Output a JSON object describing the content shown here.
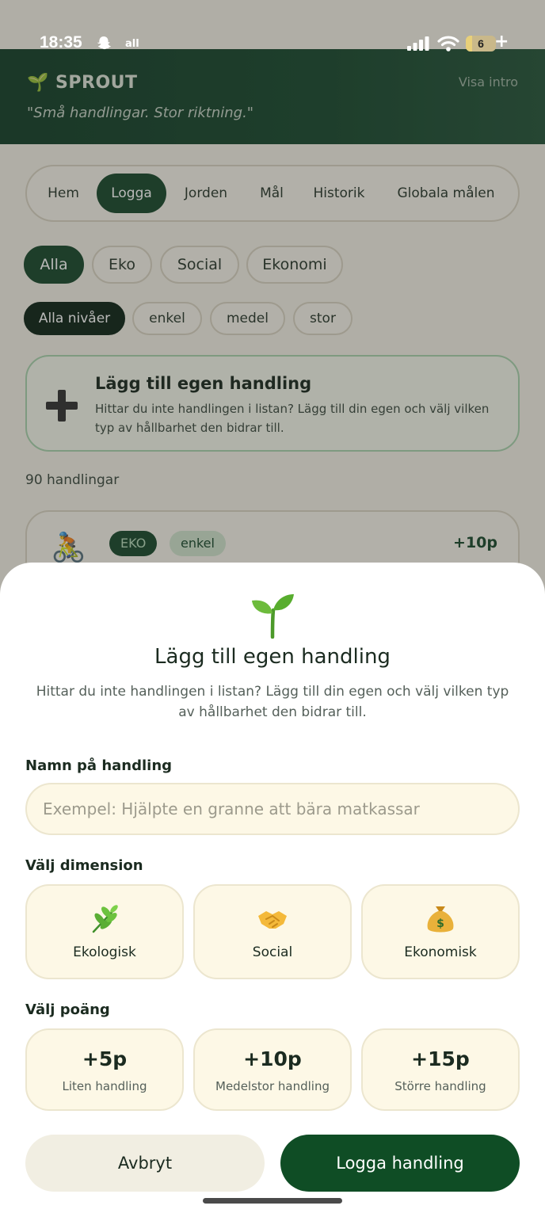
{
  "status_bar": {
    "time": "18:35",
    "network": "all",
    "battery": "6"
  },
  "header": {
    "brand": "🌱 SPROUT",
    "intro_link": "Visa intro",
    "tagline": "\"Små handlingar. Stor riktning.\""
  },
  "tabs": [
    "Hem",
    "Logga",
    "Jorden",
    "Mål",
    "Historik",
    "Globala målen"
  ],
  "active_tab": "Logga",
  "categories": [
    "Alla",
    "Eko",
    "Social",
    "Ekonomi"
  ],
  "levels": [
    "Alla nivåer",
    "enkel",
    "medel",
    "stor"
  ],
  "add_card": {
    "title": "Lägg till egen handling",
    "description": "Hittar du inte handlingen i listan? Lägg till din egen och välj vilken typ av hållbarhet den bidrar till."
  },
  "count": "90 handlingar",
  "first_item": {
    "badge_category": "EKO",
    "badge_level": "enkel",
    "points": "+10p"
  },
  "modal": {
    "title": "Lägg till egen handling",
    "description": "Hittar du inte handlingen i listan? Lägg till din egen och välj vilken typ av hållbarhet den bidrar till.",
    "name_label": "Namn på handling",
    "name_placeholder": "Exempel: Hjälpte en granne att bära matkassar",
    "name_value": "",
    "dimension_label": "Välj dimension",
    "dimensions": [
      {
        "label": "Ekologisk",
        "icon": "herb-icon"
      },
      {
        "label": "Social",
        "icon": "handshake-icon"
      },
      {
        "label": "Ekonomisk",
        "icon": "money-bag-icon"
      }
    ],
    "points_label": "Välj poäng",
    "points": [
      {
        "value": "+5p",
        "label": "Liten handling"
      },
      {
        "value": "+10p",
        "label": "Medelstor handling"
      },
      {
        "value": "+15p",
        "label": "Större handling"
      }
    ],
    "cancel_label": "Avbryt",
    "submit_label": "Logga handling"
  },
  "colors": {
    "primary": "#1a4a2e",
    "button_dark": "#0f4d25",
    "field_bg": "#fdf8e6"
  }
}
